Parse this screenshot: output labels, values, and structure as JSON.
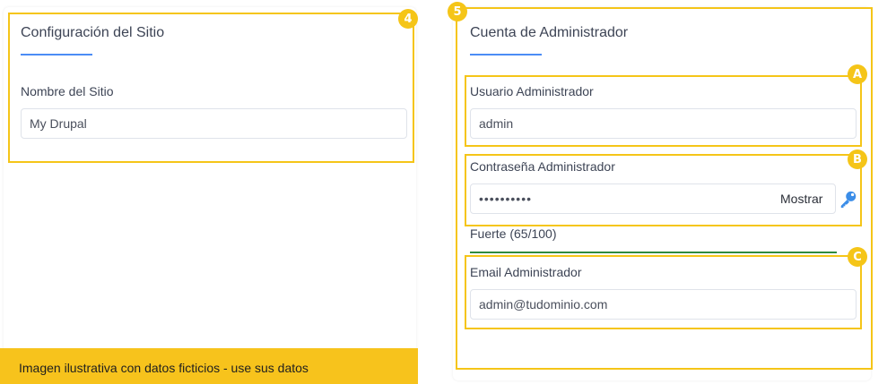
{
  "site_config": {
    "badge": "4",
    "title": "Configuración del Sitio",
    "site_name_label": "Nombre del Sitio",
    "site_name_value": "My Drupal"
  },
  "admin_account": {
    "badge": "5",
    "title": "Cuenta de Administrador",
    "username": {
      "badge": "A",
      "label": "Usuario Administrador",
      "value": "admin"
    },
    "password": {
      "badge": "B",
      "label": "Contraseña Administrador",
      "value": "••••••••••",
      "show_label": "Mostrar",
      "key_icon": "key-icon"
    },
    "strength": {
      "text": "Fuerte (65/100)",
      "value": 0.65,
      "color": "#2e8b3e"
    },
    "email": {
      "badge": "C",
      "label": "Email Administrador",
      "value": "admin@tudominio.com"
    }
  },
  "notice": "Imagen ilustrativa con datos ficticios - use sus datos",
  "colors": {
    "highlight": "#f5c518",
    "accent": "#4b8cf5",
    "notice_bg": "#f7c31c"
  }
}
